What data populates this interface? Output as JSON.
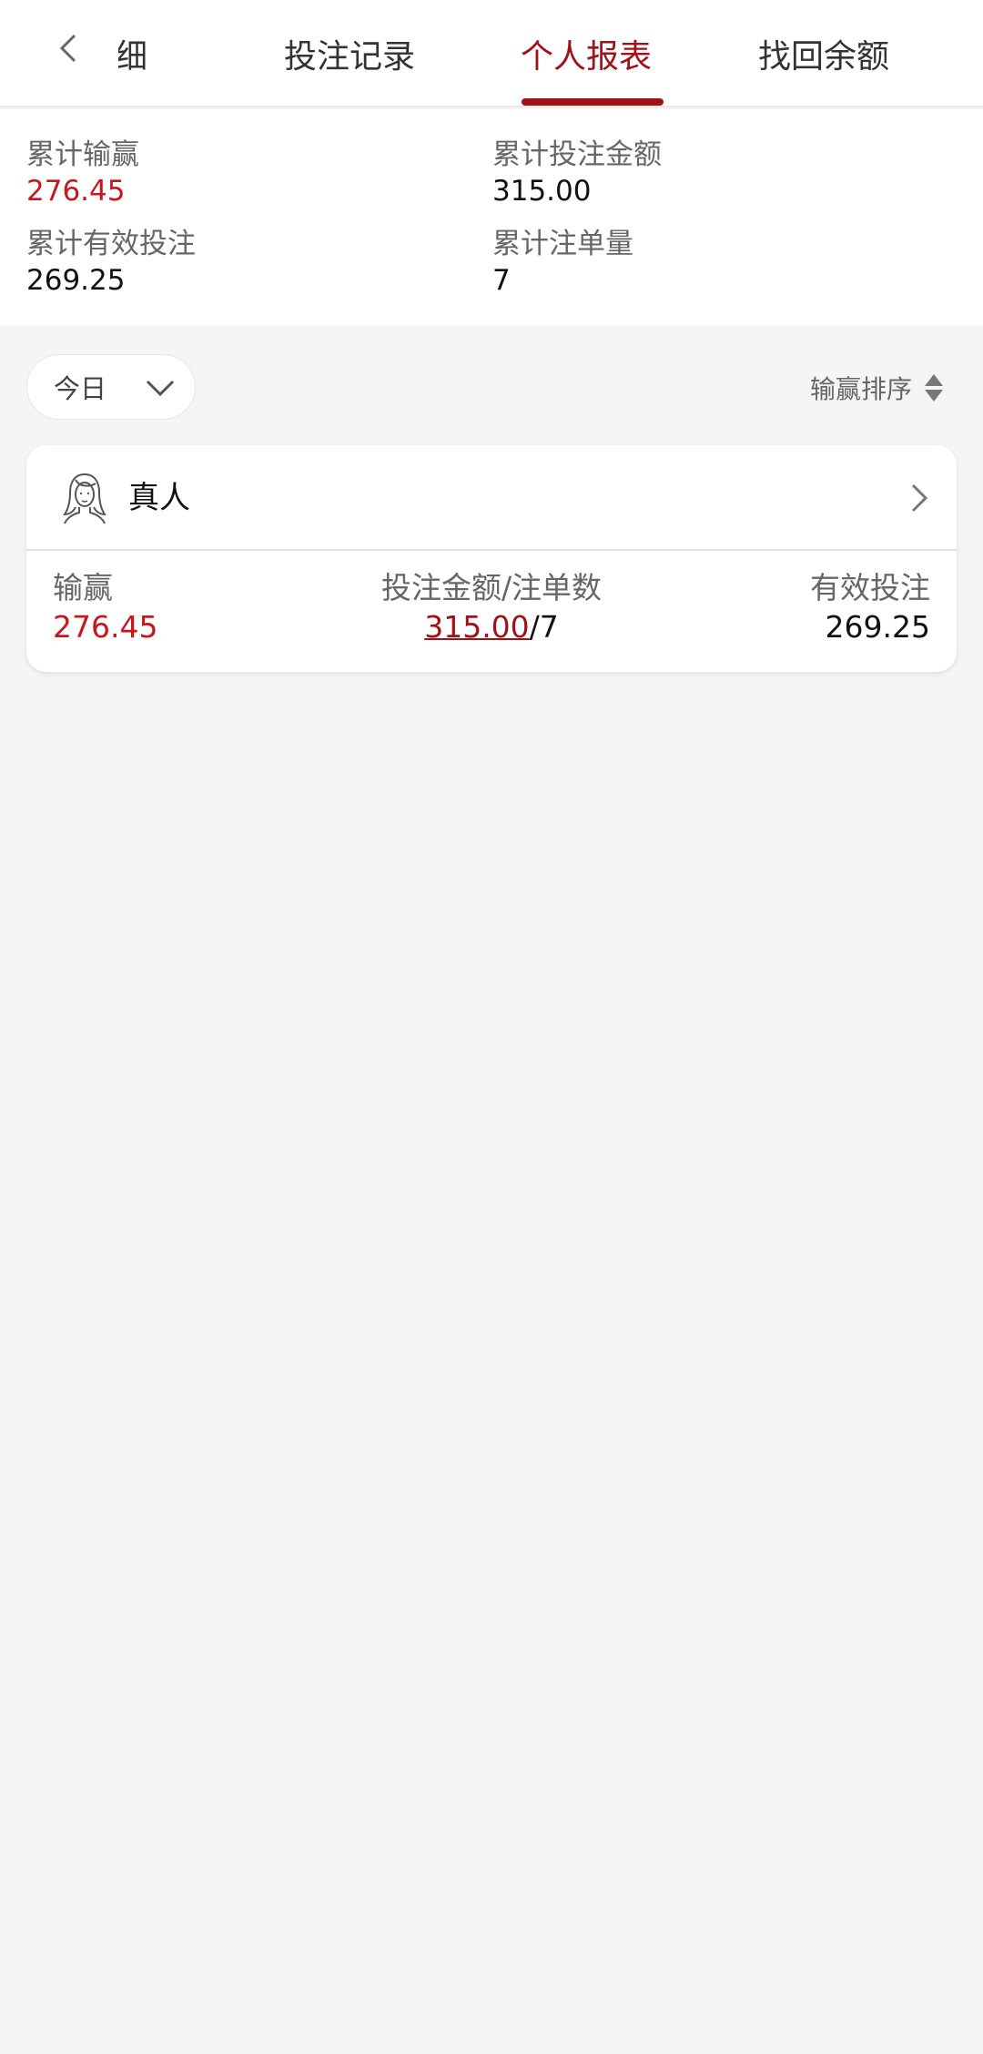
{
  "tabs": [
    {
      "label": "明细"
    },
    {
      "label": "投注记录"
    },
    {
      "label": "个人报表"
    },
    {
      "label": "找回余额"
    }
  ],
  "colors": {
    "accent": "#a01218",
    "positive": "#c8161d"
  },
  "summary": {
    "total_win_loss": {
      "label": "累计输赢",
      "value": "276.45"
    },
    "total_bet_amount": {
      "label": "累计投注金额",
      "value": "315.00"
    },
    "total_valid_bet": {
      "label": "累计有效投注",
      "value": "269.25"
    },
    "total_bet_count": {
      "label": "累计注单量",
      "value": "7"
    }
  },
  "filter": {
    "selected": "今日"
  },
  "sort": {
    "label": "输赢排序"
  },
  "cards": [
    {
      "title": "真人",
      "icon": "woman-portrait-icon",
      "win_loss": {
        "label": "输赢",
        "value": "276.45"
      },
      "bet": {
        "label": "投注金额/注单数",
        "amount": "315.00",
        "count": "/7"
      },
      "valid_bet": {
        "label": "有效投注",
        "value": "269.25"
      }
    }
  ]
}
